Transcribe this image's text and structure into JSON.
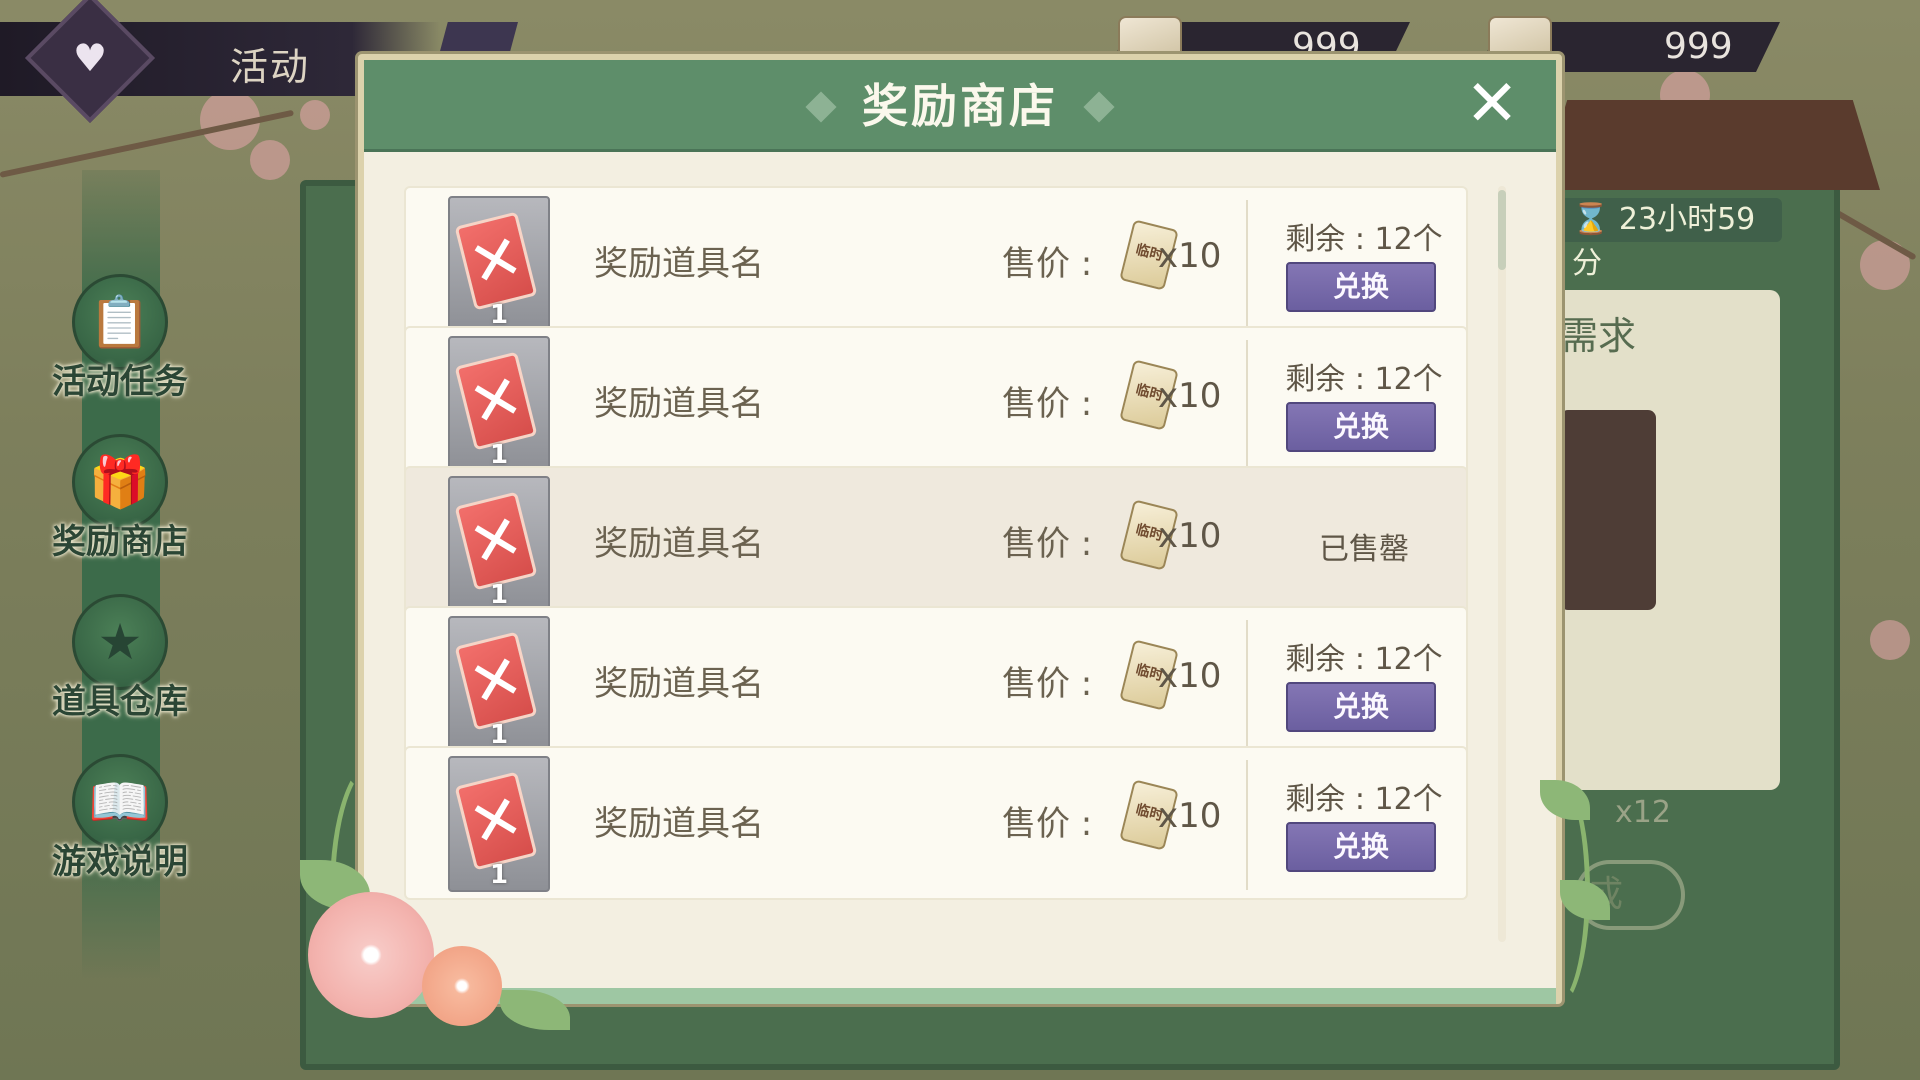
{
  "top_bar": {
    "title": "活动",
    "currency_1": "999",
    "currency_2": "999"
  },
  "sidebar": {
    "items": [
      {
        "label": "活动任务",
        "icon": "clipboard-icon"
      },
      {
        "label": "奖励商店",
        "icon": "gift-icon"
      },
      {
        "label": "道具仓库",
        "icon": "star-icon"
      },
      {
        "label": "游戏说明",
        "icon": "book-icon"
      }
    ]
  },
  "background_panel": {
    "timer": "23小时59分",
    "need_label": "需求",
    "count_label": "x12",
    "button_partial": "成"
  },
  "modal": {
    "title": "奖励商店",
    "close_icon": "close-icon",
    "items": [
      {
        "name": "奖励道具名",
        "price_label": "售价 :",
        "coupon_text": "临时",
        "price_qty": "x10",
        "count": "1",
        "status": "available",
        "remaining": "剩余 : 12个",
        "button": "兑换"
      },
      {
        "name": "奖励道具名",
        "price_label": "售价 :",
        "coupon_text": "临时",
        "price_qty": "x10",
        "count": "1",
        "status": "available",
        "remaining": "剩余 : 12个",
        "button": "兑换"
      },
      {
        "name": "奖励道具名",
        "price_label": "售价 :",
        "coupon_text": "临时",
        "price_qty": "x10",
        "count": "1",
        "status": "soldout",
        "soldout_text": "已售罄"
      },
      {
        "name": "奖励道具名",
        "price_label": "售价 :",
        "coupon_text": "临时",
        "price_qty": "x10",
        "count": "1",
        "status": "available",
        "remaining": "剩余 : 12个",
        "button": "兑换"
      },
      {
        "name": "奖励道具名",
        "price_label": "售价 :",
        "coupon_text": "临时",
        "price_qty": "x10",
        "count": "1",
        "status": "available",
        "remaining": "剩余 : 12个",
        "button": "兑换"
      }
    ]
  },
  "colors": {
    "header_green": "#5e8e6a",
    "button_purple": "#7466a8",
    "panel_cream": "#f3efe1"
  }
}
